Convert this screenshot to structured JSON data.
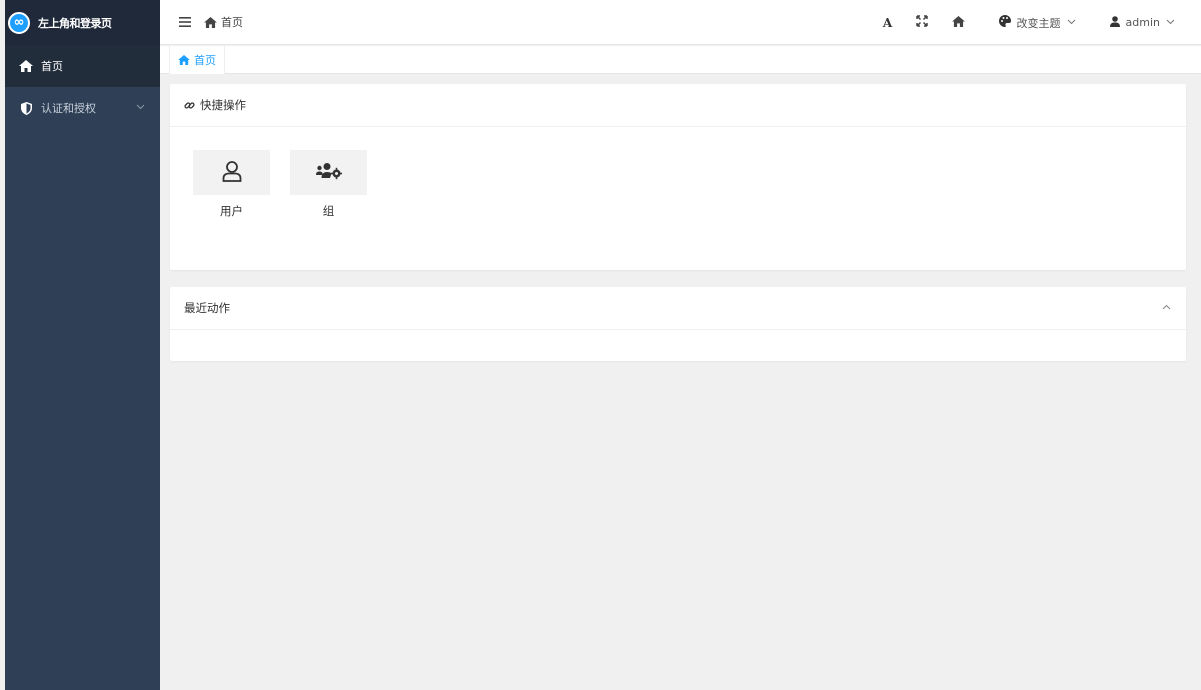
{
  "app": {
    "title": "左上角和登录页",
    "logo_symbol": "∞"
  },
  "sidebar": {
    "items": [
      {
        "label": "首页",
        "icon": "home-icon",
        "active": true
      },
      {
        "label": "认证和授权",
        "icon": "shield-icon",
        "expandable": true
      }
    ]
  },
  "header": {
    "menu_icon": "menu-icon",
    "breadcrumb": "首页",
    "font_button": "A",
    "theme_label": "改变主题",
    "user_label": "admin"
  },
  "tabs": [
    {
      "label": "首页",
      "icon": "home-icon",
      "active": true
    }
  ],
  "quick_actions": {
    "title": "快捷操作",
    "items": [
      {
        "label": "用户",
        "icon": "user-icon"
      },
      {
        "label": "组",
        "icon": "users-cog-icon"
      }
    ]
  },
  "recent_actions": {
    "title": "最近动作"
  },
  "colors": {
    "sidebar": "#2f4056",
    "logo_bg": "#20293a",
    "accent": "#1e9fff",
    "page_bg": "#f0f0f0"
  }
}
